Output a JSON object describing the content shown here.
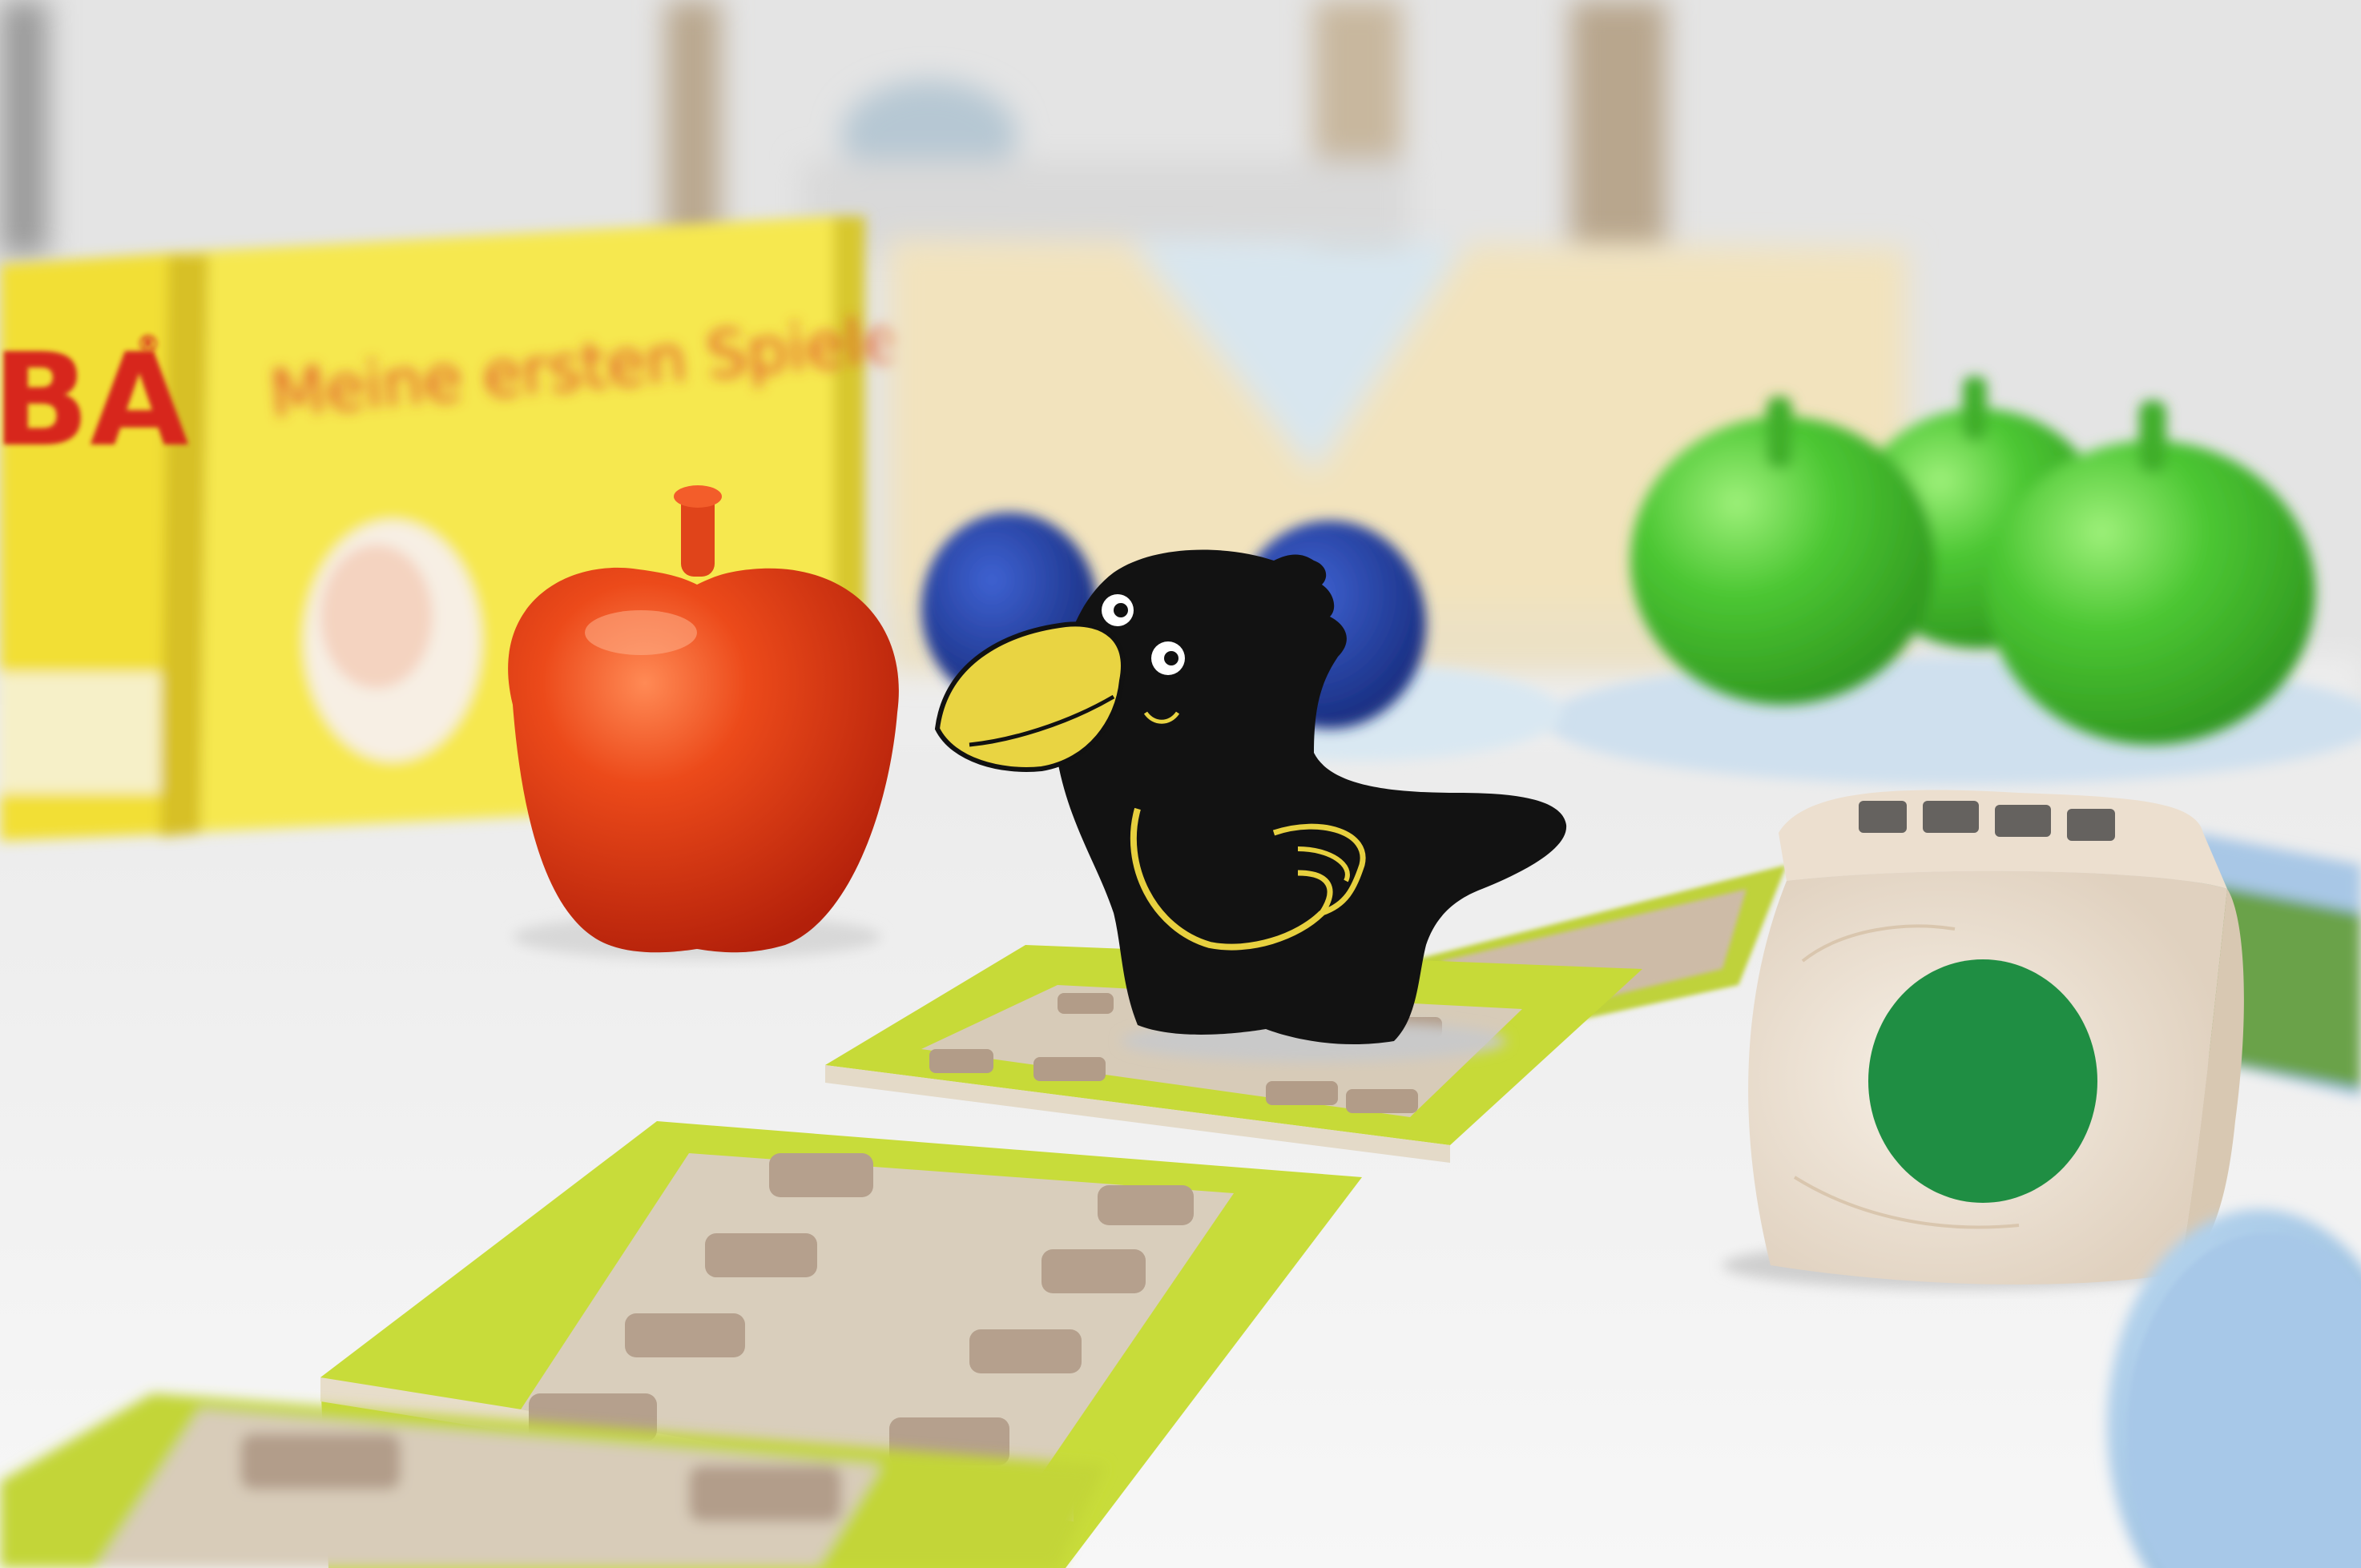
{
  "box": {
    "brand": "BA",
    "registered": "®",
    "title_line": "Meine ersten Spiele"
  },
  "die": {
    "face_color": "#1f8e43"
  },
  "colors": {
    "table": "#f2f2f2",
    "wall": "#e6e6e6",
    "box_yellow": "#f3e23b",
    "red_apple": "#e23a12",
    "green_apple": "#45c42d",
    "blue_ball": "#1f3aa0",
    "raven_body": "#111111",
    "raven_beak": "#e7d03f",
    "tile_green": "#c9dd3a",
    "path_stone": "#b7a08c",
    "plate_blue": "#a9c9e6"
  },
  "icons": [
    "raven-piece",
    "red-apple",
    "green-apple",
    "blue-ball",
    "wooden-die",
    "path-tile",
    "game-box"
  ]
}
